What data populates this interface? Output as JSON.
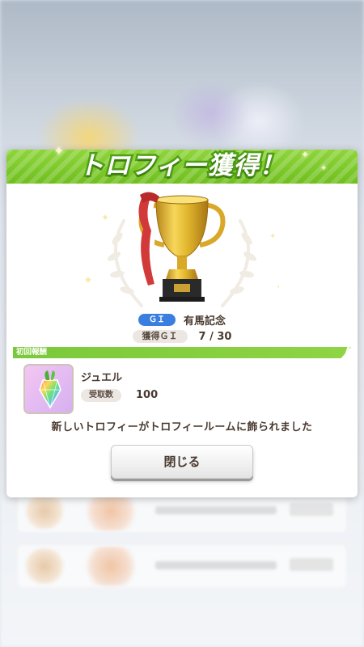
{
  "dialog": {
    "title": "トロフィー獲得！",
    "grade_badge": "ＧＩ",
    "race_name": "有馬記念",
    "count_label": "獲得ＧＩ",
    "count_value": "7 / 30",
    "section_title": "初回報酬",
    "reward_name": "ジュエル",
    "reward_qty_label": "受取数",
    "reward_qty": "100",
    "message": "新しいトロフィーがトロフィールームに飾られました",
    "close_label": "閉じる"
  },
  "colors": {
    "header_green": "#7cc62c",
    "badge_blue": "#3a7fe0",
    "text_brown": "#4a3a30",
    "trophy_gold": "#e2b72e",
    "ribbon_red": "#d23a3a"
  },
  "icons": {
    "trophy": "trophy-icon",
    "jewel": "jewel-icon"
  }
}
